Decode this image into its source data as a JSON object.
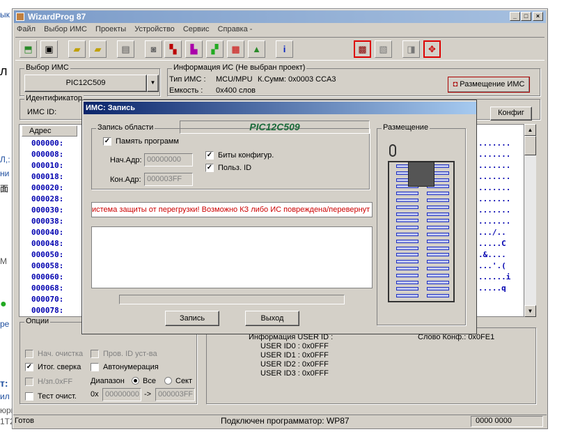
{
  "background": {
    "fragments": [
      "ык",
      "л",
      "Л,:",
      "ни",
      "面",
      "М",
      "ре",
      "т:",
      "ил з",
      "юрп",
      "1Т2"
    ]
  },
  "window": {
    "title": "WizardProg 87",
    "menu": [
      "Файл",
      "Выбор ИМС",
      "Проекты",
      "Устройство",
      "Сервис",
      "Справка -"
    ],
    "chip_select": {
      "label": "Выбор ИМС",
      "value": "PIC12C509"
    },
    "info": {
      "label": "Информация ИС (Не выбран проект)",
      "type_label": "Тип ИМС :",
      "type_value": "MCU/MPU",
      "checksum": "К.Сумм: 0x0003 CCA3",
      "capacity_label": "Емкость :",
      "capacity_value": "0x400 слов"
    },
    "placement_button": "Размещение ИМС",
    "ident_label": "Идентификатор",
    "ims_id_label": "ИМС ID:",
    "config_button": "Конфиг",
    "hex_header": "Адрес",
    "addresses": [
      "000000:",
      "000008:",
      "000010:",
      "000018:",
      "000020:",
      "000028:",
      "000030:",
      "000038:",
      "000040:",
      "000048:",
      "000050:",
      "000058:",
      "000060:",
      "000068:",
      "000070:",
      "000078:"
    ],
    "ascii": [
      ".......",
      ".......",
      ".......",
      ".......",
      ".......",
      ".......",
      ".......",
      ".......",
      ".../..",
      ".....C",
      ".&....",
      "...'.(",
      "......i",
      ".....q",
      "",
      ""
    ],
    "options": {
      "label": "Опции",
      "items": [
        {
          "label": "Нач. очистка",
          "checked": false,
          "disabled": true
        },
        {
          "label": "Пров. ID уст-ва",
          "checked": false,
          "disabled": true
        },
        {
          "label": "Итог. сверка",
          "checked": true,
          "disabled": false
        },
        {
          "label": "Автонумерация",
          "checked": false,
          "disabled": false
        },
        {
          "label": "Н/зп.0xFF",
          "checked": false,
          "disabled": true
        },
        {
          "label": "Тест очист.",
          "checked": false,
          "disabled": false
        }
      ],
      "range_label": "Диапазон",
      "range_all": "Все",
      "range_sect": "Сект",
      "prefix": "0x",
      "from": "00000000",
      "arrow": "->",
      "to": "000003FF"
    },
    "userid": {
      "title": "Информация USER ID :",
      "lines": [
        "USER ID0 : 0x0FFF",
        "USER ID1 : 0x0FFF",
        "USER ID2 : 0x0FFF",
        "USER ID3 : 0x0FFF"
      ],
      "config_word": "Слово Конф.: 0x0FE1"
    },
    "status": {
      "left": "Готов",
      "center": "Подключен программатор: WP87",
      "right": "0000 0000"
    }
  },
  "dialog": {
    "title": "ИМС: Запись",
    "area_label": "Запись области",
    "chip_name": "PIC12C509",
    "program_memory": "Память программ",
    "start_label": "Нач.Адр:",
    "start_value": "00000000",
    "end_label": "Кон.Адр:",
    "end_value": "000003FF",
    "config_bits": "Биты конфигур.",
    "user_id": "Польз. ID",
    "error_text": "истема защиты от перегрузки! Возможно КЗ либо ИС повреждена/перевернут",
    "placement_label": "Размещение",
    "write_button": "Запись",
    "exit_button": "Выход",
    "progress": 0
  },
  "colors": {
    "accent": "#0a246a",
    "error": "#cc0000",
    "hex_text": "#0000b0"
  }
}
